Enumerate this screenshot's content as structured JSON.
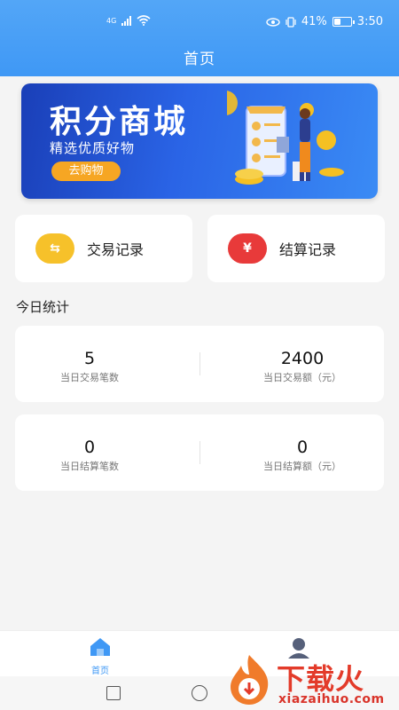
{
  "status_bar": {
    "network": "4G",
    "battery_percent": "41%",
    "time": "3:50",
    "battery_level": 0.41
  },
  "header": {
    "title": "首页"
  },
  "banner": {
    "title": "积分商城",
    "subtitle": "精选优质好物",
    "button_label": "去购物"
  },
  "quick_actions": [
    {
      "label": "交易记录",
      "icon": "exchange-icon",
      "color": "#f6c12a",
      "symbol": "⇆"
    },
    {
      "label": "结算记录",
      "icon": "yen-icon",
      "color": "#e83a3a",
      "symbol": "¥"
    }
  ],
  "today": {
    "title": "今日统计",
    "rows": [
      [
        {
          "value": "5",
          "caption": "当日交易笔数"
        },
        {
          "value": "2400",
          "caption": "当日交易额（元）"
        }
      ],
      [
        {
          "value": "0",
          "caption": "当日结算笔数"
        },
        {
          "value": "0",
          "caption": "当日结算额（元）"
        }
      ]
    ]
  },
  "tabbar": {
    "home_label": "首页"
  },
  "watermark": {
    "brand": "下载火",
    "domain": "xiazaihuo.com"
  },
  "colors": {
    "primary": "#3f98f5",
    "accent": "#f6a623"
  }
}
